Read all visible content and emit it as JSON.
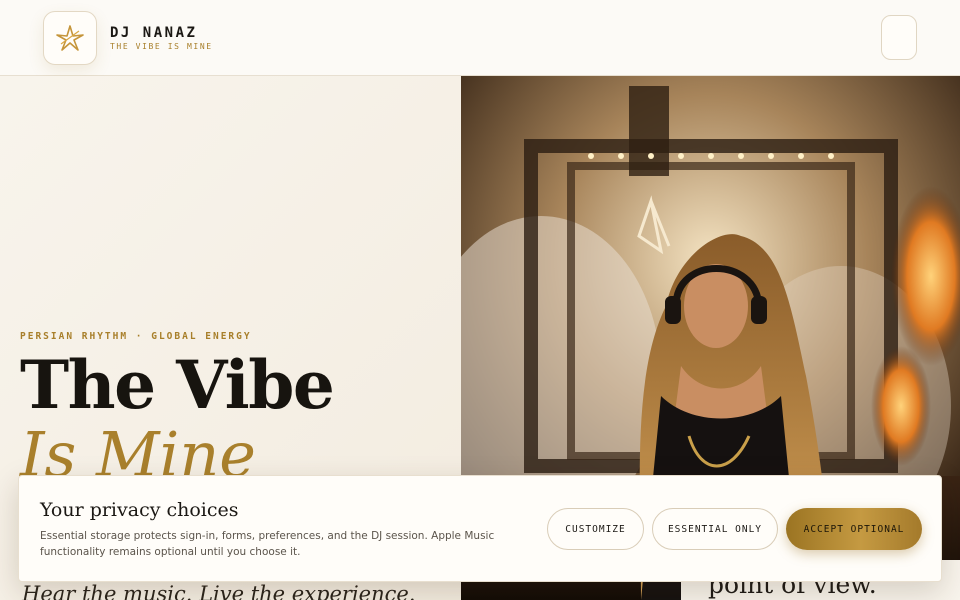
{
  "brand": {
    "name": "DJ NANAZ",
    "tagline": "THE VIBE IS MINE",
    "logo_icon": "star-icon"
  },
  "header": {
    "menu_icon": "menu-icon"
  },
  "hero": {
    "kicker": "PERSIAN RHYTHM · GLOBAL ENERGY",
    "title_line1": "The Vibe",
    "title_line2": "Is Mine",
    "subline": "Hear the music. Live the experience.",
    "image_caption": "point of view."
  },
  "consent": {
    "title": "Your privacy choices",
    "body": "Essential storage protects sign-in, forms, preferences, and the DJ session. Apple Music functionality remains optional until you choose it.",
    "buttons": {
      "customize": "CUSTOMIZE",
      "essential": "ESSENTIAL ONLY",
      "accept": "ACCEPT OPTIONAL"
    }
  },
  "colors": {
    "accent_gold": "#a9802c",
    "background": "#f6f1e8",
    "text": "#17140f"
  }
}
